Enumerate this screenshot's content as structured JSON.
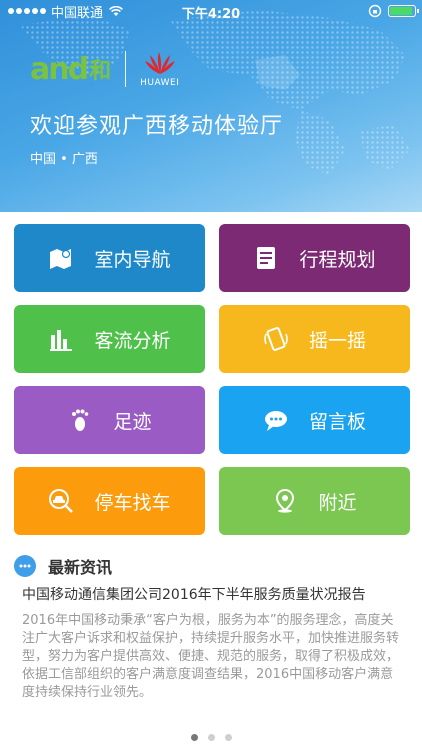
{
  "status_bar": {
    "carrier": "中国联通",
    "time": "下午4:20",
    "battery_level": 0.9
  },
  "banner": {
    "logo_and": "and",
    "logo_he": "和",
    "partner": "HUAWEI",
    "welcome": "欢迎参观广西移动体验厅",
    "location": "中国 • 广西"
  },
  "tiles": [
    {
      "label": "室内导航",
      "color": "#1e88c9",
      "icon": "map-icon"
    },
    {
      "label": "行程规划",
      "color": "#7b2a73",
      "icon": "document-icon"
    },
    {
      "label": "客流分析",
      "color": "#4fc14a",
      "icon": "bar-chart-icon"
    },
    {
      "label": "摇一摇",
      "color": "#f6b81c",
      "icon": "shake-phone-icon"
    },
    {
      "label": "足迹",
      "color": "#9a5bc4",
      "icon": "footprint-icon"
    },
    {
      "label": "留言板",
      "color": "#19a3f0",
      "icon": "chat-bubble-icon"
    },
    {
      "label": "停车找车",
      "color": "#fc9b0c",
      "icon": "car-icon"
    },
    {
      "label": "附近",
      "color": "#7cc652",
      "icon": "location-pin-icon"
    }
  ],
  "news": {
    "section_title": "最新资讯",
    "headline": "中国移动通信集团公司2016年下半年服务质量状况报告",
    "body": "2016年中国移动秉承“客户为根，服务为本”的服务理念，高度关注广大客户诉求和权益保护，持续提升服务水平，加快推进服务转型，努力为客户提供高效、便捷、规范的服务，取得了积极成效，依据工信部组织的客户满意度调查结果，2016中国移动客户满意度持续保持行业领先。"
  },
  "pager": {
    "count": 3,
    "active": 0
  }
}
